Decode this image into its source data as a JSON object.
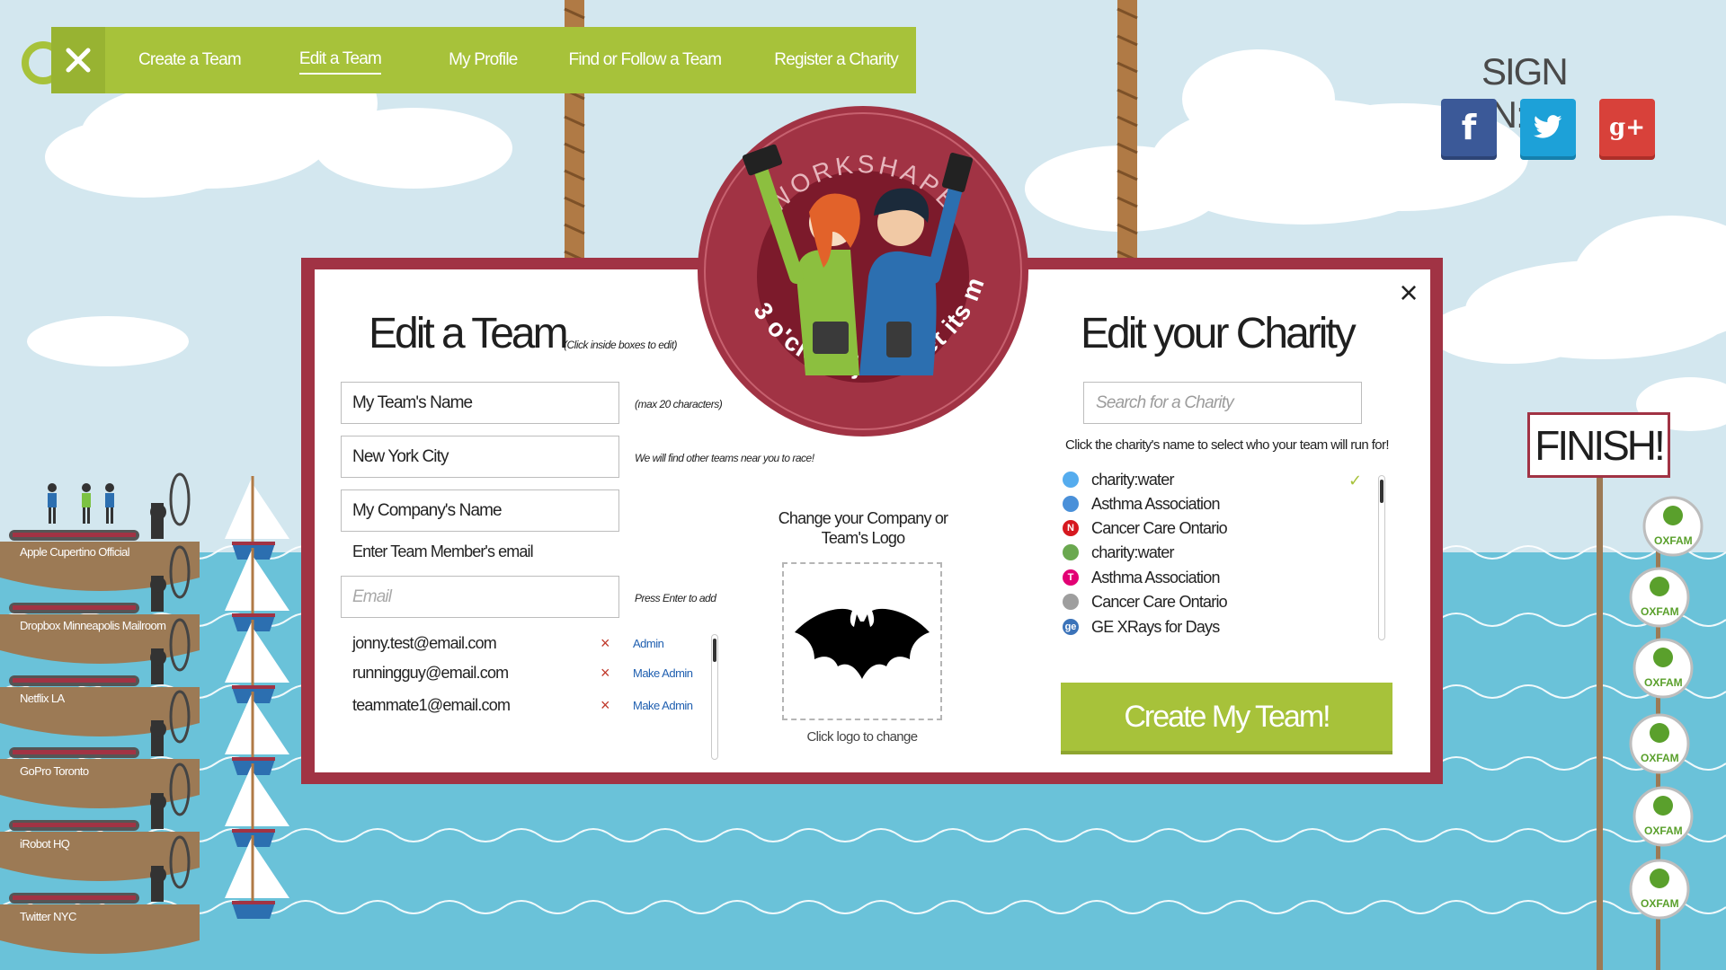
{
  "nav": {
    "items": [
      {
        "label": "Create a Team",
        "active": false
      },
      {
        "label": "Edit a Team",
        "active": true
      },
      {
        "label": "My Profile",
        "active": false
      },
      {
        "label": "Find or Follow a Team",
        "active": false
      },
      {
        "label": "Register a Charity",
        "active": false
      }
    ]
  },
  "signin": {
    "title": "SIGN IN:",
    "facebook": "f",
    "google": "g+"
  },
  "badge": {
    "top_text": "WORKSHAPE",
    "bottom_text": "3 o'clock just met its match"
  },
  "edit_team": {
    "title": "Edit a Team",
    "title_hint": "(Click inside boxes to edit)",
    "team_name": "My Team's Name",
    "team_name_hint": "(max 20 characters)",
    "city": "New York City",
    "city_hint": "We will find other teams near you to race!",
    "company": "My Company's Name",
    "members_label": "Enter Team Member's email",
    "email_placeholder": "Email",
    "email_hint": "Press Enter to add",
    "members": [
      {
        "email": "jonny.test@email.com",
        "action": "Admin"
      },
      {
        "email": "runningguy@email.com",
        "action": "Make Admin"
      },
      {
        "email": "teammate1@email.com",
        "action": "Make Admin"
      }
    ],
    "remove_glyph": "×"
  },
  "logo": {
    "title": "Change your Company or Team's Logo",
    "caption": "Click logo to change"
  },
  "charity": {
    "title": "Edit your Charity",
    "search_placeholder": "Search for a Charity",
    "hint": "Click the charity's name to select who your team will run for!",
    "items": [
      {
        "name": "charity:water",
        "icon": "twitter-icon",
        "color": "#55acee",
        "glyph": ""
      },
      {
        "name": "Asthma Association",
        "icon": "dropbox-icon",
        "color": "#4a90d9",
        "glyph": ""
      },
      {
        "name": "Cancer Care Ontario",
        "icon": "netflix-icon",
        "color": "#d6181f",
        "glyph": "N"
      },
      {
        "name": "charity:water",
        "icon": "fitbit-icon",
        "color": "#6aa84f",
        "glyph": ""
      },
      {
        "name": "Asthma Association",
        "icon": "tmobile-icon",
        "color": "#e20074",
        "glyph": "T"
      },
      {
        "name": "Cancer Care Ontario",
        "icon": "generic-icon",
        "color": "#9e9e9e",
        "glyph": ""
      },
      {
        "name": "GE XRays for Days",
        "icon": "ge-icon",
        "color": "#3b73b9",
        "glyph": "ge"
      }
    ],
    "selected_check": "✓",
    "button": "Create My Team!"
  },
  "finish": "FINISH!",
  "teams": [
    "Apple Cupertino Official",
    "Dropbox Minneapolis Mailroom",
    "Netflix LA",
    "GoPro Toronto",
    "iRobot HQ",
    "Twitter NYC"
  ],
  "oxfam_label": "OXFAM",
  "colors": {
    "nav_green": "#a7c23a",
    "modal_border": "#a13344",
    "sea": "#6ac2d9",
    "sky": "#d3e7ef"
  },
  "close_glyph": "×"
}
